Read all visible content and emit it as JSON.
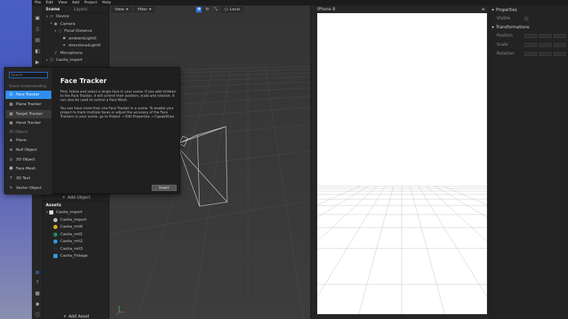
{
  "menu": [
    "File",
    "Edit",
    "View",
    "Add",
    "Project",
    "Help"
  ],
  "scene": {
    "tabs": [
      "Scene",
      "Layers"
    ],
    "tree": [
      {
        "label": "Device",
        "indent": 0,
        "tri": "▾",
        "icon": "▭"
      },
      {
        "label": "Camera",
        "indent": 1,
        "tri": "▾",
        "icon": "◉"
      },
      {
        "label": "Focal Distance",
        "indent": 2,
        "tri": "▾",
        "icon": "◌"
      },
      {
        "label": "ambientLight0",
        "indent": 3,
        "tri": "",
        "icon": "✺"
      },
      {
        "label": "directionalLight0",
        "indent": 3,
        "tri": "",
        "icon": "✦"
      },
      {
        "label": "Microphone",
        "indent": 1,
        "tri": "",
        "icon": "♪"
      },
      {
        "label": "Casita_import",
        "indent": 0,
        "tri": "▸",
        "icon": "⬡"
      }
    ],
    "add_object": "Add Object"
  },
  "assets": {
    "title": "Assets",
    "items": [
      {
        "label": "Casita_import",
        "indent": 0,
        "tri": "▾",
        "color": "#d8d8d8",
        "shape": "doc"
      },
      {
        "label": "Casita_import",
        "indent": 1,
        "tri": "",
        "color": "#c0c0c0",
        "shape": "circle"
      },
      {
        "label": "Casita_mtl0",
        "indent": 1,
        "tri": "",
        "color": "#d4b21a",
        "shape": "circle"
      },
      {
        "label": "Casita_mtl1",
        "indent": 1,
        "tri": "",
        "color": "#1f8a6a",
        "shape": "circle"
      },
      {
        "label": "Casita_mtl2",
        "indent": 1,
        "tri": "",
        "color": "#2a9ee6",
        "shape": "circle"
      },
      {
        "label": "Casita_mtl3",
        "indent": 1,
        "tri": "",
        "color": "#2b2b2b",
        "shape": "circle"
      },
      {
        "label": "Casita_Foliage",
        "indent": 1,
        "tri": "",
        "color": "#2aa0e0",
        "shape": "square"
      }
    ],
    "add_asset": "Add Asset"
  },
  "viewport": {
    "view_label": "View",
    "filter_label": "Filter",
    "space_label": "Local"
  },
  "device": {
    "name": "iPhone 8"
  },
  "properties": {
    "title": "Properties",
    "visible_label": "Visible",
    "transformations_label": "Transformations",
    "rows": [
      "Position",
      "Scale",
      "Rotation"
    ]
  },
  "popup": {
    "search_placeholder": "Search",
    "category_scene": "Scene Understanding",
    "category_3d": "3D Objects",
    "items_scene": [
      {
        "label": "Face Tracker",
        "icon": "☺",
        "state": "selected"
      },
      {
        "label": "Plane Tracker",
        "icon": "▦",
        "state": ""
      },
      {
        "label": "Target Tracker",
        "icon": "▦",
        "state": "hover"
      },
      {
        "label": "Hand Tracker",
        "icon": "▦",
        "state": ""
      }
    ],
    "items_3d": [
      {
        "label": "Plane",
        "icon": "◈",
        "state": ""
      },
      {
        "label": "Null Object",
        "icon": "⊕",
        "state": ""
      },
      {
        "label": "3D Object",
        "icon": "◎",
        "state": ""
      },
      {
        "label": "Face Mesh",
        "icon": "☻",
        "state": ""
      },
      {
        "label": "3D Text",
        "icon": "T",
        "state": ""
      },
      {
        "label": "Vector Object",
        "icon": "✎",
        "state": ""
      }
    ],
    "title": "Face Tracker",
    "desc1": "Find, follow and select a single face in your scene. If you add children to the Face Tracker, it will control their position, scale and rotation. It can also be used to control a Face Mesh.",
    "desc2": "You can have more than one Face Tracker in a scene. To enable your project to track multiple faces or adjust the accuracy of the Face Trackers in your scene, go to Project → Edit Properties → Capabilities.",
    "insert_label": "Insert"
  },
  "colors": {
    "accent": "#2f8ff0",
    "panel": "#232323",
    "viewport": "#3a3a3a"
  }
}
